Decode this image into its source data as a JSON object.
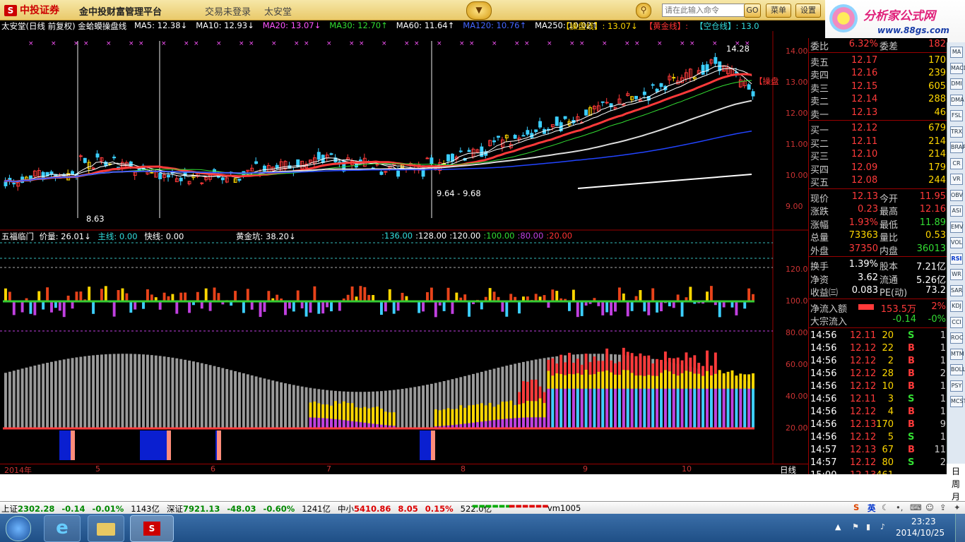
{
  "colors": {
    "up": "#ff3a3a",
    "down": "#3ccfff",
    "yellow": "#ffd700",
    "purple": "#c040e0",
    "green": "#33cc33",
    "grid": "#9a0000"
  },
  "topbar": {
    "brand": "中投证券",
    "platform": "金中投财富管理平台",
    "login_status": "交易未登录",
    "stock_name": "太安堂",
    "search_placeholder": "请在此输入命令",
    "go_label": "GO",
    "menu_label": "菜单",
    "settings_label": "设置"
  },
  "site": {
    "title": "分析家公式网",
    "url": "www.88gs.com"
  },
  "main_chart": {
    "indicator_line": "太安堂(日线 前复权) 金蛤蟆操盘线",
    "ma": [
      {
        "label": "MA5: 12.38↓",
        "color": "#ffffff"
      },
      {
        "label": "MA10: 12.93↓",
        "color": "#ffffff"
      },
      {
        "label": "MA20: 13.07↓",
        "color": "#ff55ff"
      },
      {
        "label": "MA30: 12.70↑",
        "color": "#33dd33"
      },
      {
        "label": "MA60: 11.64↑",
        "color": "#ffffff"
      },
      {
        "label": "MA120: 10.76↑",
        "color": "#4466ff"
      },
      {
        "label": "MA250: 10.02↑",
        "color": "#ffffff"
      }
    ],
    "tags": [
      {
        "label": "【操盘线】: 13.07↓",
        "color": "#ffd700"
      },
      {
        "label": "【黄金线】:",
        "color": "#ff3333"
      },
      {
        "label": "【空仓线】: 13.0",
        "color": "#33dddd"
      }
    ],
    "y_ticks": [
      "14.00",
      "13.00",
      "12.00",
      "11.00",
      "10.00",
      "9.00"
    ],
    "annotations": {
      "high": "14.28",
      "low": "8.63",
      "range": "9.64 - 9.68",
      "side_tag": "【操盘"
    }
  },
  "sub_chart": {
    "title": "五福临门",
    "price_label": "价量: 26.01↓",
    "main_label": "主线: 0.00",
    "fast_label": "快线: 0.00",
    "gold_label": "黄金坑: 38.20↓",
    "levels": [
      {
        "label": ":136.00",
        "color": "#33dddd"
      },
      {
        "label": ":128.00",
        "color": "#ffffff"
      },
      {
        "label": ":120.00",
        "color": "#ffffff"
      },
      {
        "label": ":100.00",
        "color": "#33dd33"
      },
      {
        "label": ":80.00",
        "color": "#c040e0"
      },
      {
        "label": ":20.00",
        "color": "#ff3333"
      }
    ],
    "y_ticks": [
      "120.0",
      "100.0",
      "80.00",
      "60.00",
      "40.00",
      "20.00"
    ]
  },
  "date_axis": {
    "labels": [
      "2014年",
      "5",
      "6",
      "7",
      "8",
      "9",
      "10"
    ],
    "period": "日线"
  },
  "period_tabs": [
    "日",
    "周",
    "月"
  ],
  "quote": {
    "committee": [
      {
        "l": "委比",
        "v": "6.32%",
        "l2": "委差",
        "v2": "182"
      }
    ],
    "sell": [
      {
        "l": "卖五",
        "p": "12.17",
        "v": "170"
      },
      {
        "l": "卖四",
        "p": "12.16",
        "v": "239"
      },
      {
        "l": "卖三",
        "p": "12.15",
        "v": "605"
      },
      {
        "l": "卖二",
        "p": "12.14",
        "v": "288"
      },
      {
        "l": "卖一",
        "p": "12.13",
        "v": "46"
      }
    ],
    "buy": [
      {
        "l": "买一",
        "p": "12.12",
        "v": "679"
      },
      {
        "l": "买二",
        "p": "12.11",
        "v": "214"
      },
      {
        "l": "买三",
        "p": "12.10",
        "v": "214"
      },
      {
        "l": "买四",
        "p": "12.09",
        "v": "179"
      },
      {
        "l": "买五",
        "p": "12.08",
        "v": "244"
      }
    ],
    "stats": [
      {
        "l": "现价",
        "v": "12.13",
        "l2": "今开",
        "v2": "11.95"
      },
      {
        "l": "涨跌",
        "v": "0.23",
        "l2": "最高",
        "v2": "12.16"
      },
      {
        "l": "涨幅",
        "v": "1.93%",
        "l2": "最低",
        "v2": "11.89"
      },
      {
        "l": "总量",
        "v": "73363",
        "l2": "量比",
        "v2": "0.53"
      },
      {
        "l": "外盘",
        "v": "37350",
        "l2": "内盘",
        "v2": "36013"
      }
    ],
    "stats2": [
      {
        "l": "换手",
        "v": "1.39%",
        "l2": "股本",
        "v2": "7.21亿"
      },
      {
        "l": "净资",
        "v": "3.62",
        "l2": "流通",
        "v2": "5.26亿"
      },
      {
        "l": "收益㈢",
        "v": "0.083",
        "l2": "PE(动)",
        "v2": "73.2"
      }
    ],
    "net_inflow": {
      "label": "净流入额",
      "value": "153.5万",
      "pct": "2%"
    },
    "block_inflow": {
      "label": "大宗流入",
      "value": "-0.14",
      "pct": "-0%"
    },
    "ticks": [
      [
        "14:56",
        "12.11",
        "20",
        "S",
        "1"
      ],
      [
        "14:56",
        "12.12",
        "22",
        "B",
        "1"
      ],
      [
        "14:56",
        "12.12",
        "2",
        "B",
        "1"
      ],
      [
        "14:56",
        "12.12",
        "28",
        "B",
        "2"
      ],
      [
        "14:56",
        "12.12",
        "10",
        "B",
        "1"
      ],
      [
        "14:56",
        "12.11",
        "3",
        "S",
        "1"
      ],
      [
        "14:56",
        "12.12",
        "4",
        "B",
        "1"
      ],
      [
        "14:56",
        "12.13",
        "170",
        "B",
        "9"
      ],
      [
        "14:56",
        "12.12",
        "5",
        "S",
        "1"
      ],
      [
        "14:57",
        "12.13",
        "67",
        "B",
        "11"
      ],
      [
        "14:57",
        "12.12",
        "80",
        "S",
        "2"
      ],
      [
        "15:00",
        "12.13",
        "461",
        "",
        ""
      ]
    ]
  },
  "rtool_labels": [
    "MA",
    "MACD",
    "DMI",
    "DMA",
    "FSL",
    "TRX",
    "BRAR",
    "CR",
    "VR",
    "OBV",
    "ASI",
    "EMV",
    "VOL",
    "RSI",
    "WR",
    "SAR",
    "KDJ",
    "CCI",
    "ROC",
    "MTM",
    "BOLL",
    "PSY",
    "MCST"
  ],
  "statusbar": {
    "items": [
      {
        "label": "上证",
        "value": "2302.28",
        "chg": "-0.14",
        "pct": "-0.01%",
        "amt": "1143亿"
      },
      {
        "label": "深证",
        "value": "7921.13",
        "chg": "-48.03",
        "pct": "-0.60%",
        "amt": "1241亿"
      },
      {
        "label": "中小",
        "value": "5410.86",
        "chg": "8.05",
        "pct": "0.15%",
        "amt": "522.0亿"
      }
    ],
    "server": "vm1005",
    "ime": "英"
  },
  "taskbar": {
    "time": "23:23",
    "date": "2014/10/25"
  }
}
